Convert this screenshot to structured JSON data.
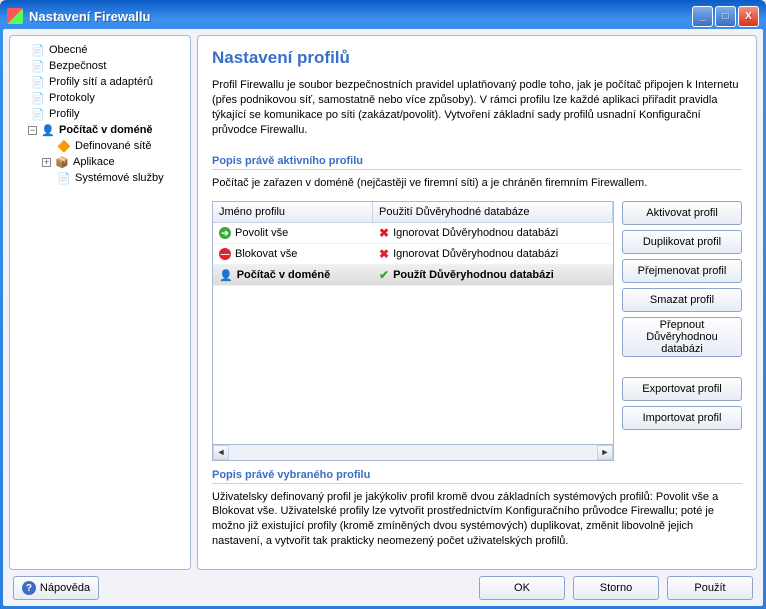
{
  "window": {
    "title": "Nastavení Firewallu",
    "buttons": {
      "min": "_",
      "max": "□",
      "close": "X"
    }
  },
  "tree": {
    "items": [
      {
        "label": "Obecné",
        "icon": "📄",
        "indent": 0,
        "expander": ""
      },
      {
        "label": "Bezpečnost",
        "icon": "📄",
        "indent": 0,
        "expander": ""
      },
      {
        "label": "Profily sítí a adaptérů",
        "icon": "📄",
        "indent": 0,
        "expander": ""
      },
      {
        "label": "Protokoly",
        "icon": "📄",
        "indent": 0,
        "expander": ""
      },
      {
        "label": "Profily",
        "icon": "📄",
        "indent": 0,
        "expander": ""
      },
      {
        "label": "Počítač v doméně",
        "icon": "👤",
        "indent": 1,
        "expander": "−",
        "bold": true
      },
      {
        "label": "Definované sítě",
        "icon": "🔶",
        "indent": 2,
        "expander": ""
      },
      {
        "label": "Aplikace",
        "icon": "📦",
        "indent": 2,
        "expander": "+"
      },
      {
        "label": "Systémové služby",
        "icon": "📄",
        "indent": 2,
        "expander": ""
      }
    ]
  },
  "content": {
    "title": "Nastavení profilů",
    "intro": "Profil Firewallu je soubor bezpečnostních pravidel uplatňovaný podle toho, jak je počítač připojen k Internetu (přes podnikovou síť, samostatně nebo více způsoby). V rámci profilu lze každé aplikaci přiřadit pravidla týkající se komunikace po síti (zakázat/povolit). Vytvoření základní sady profilů usnadní Konfigurační průvodce Firewallu.",
    "active_head": "Popis právě aktivního profilu",
    "active_text": "Počítač je zařazen v doméně (nejčastěji ve firemní síti) a je chráněn firemním Firewallem.",
    "table": {
      "col_name": "Jméno profilu",
      "col_db": "Použití Důvěryhodné databáze",
      "rows": [
        {
          "name": "Povolit vše",
          "db": "Ignorovat Důvěryhodnou databázi",
          "icon": "green",
          "use": false,
          "selected": false
        },
        {
          "name": "Blokovat vše",
          "db": "Ignorovat Důvěryhodnou databázi",
          "icon": "red",
          "use": false,
          "selected": false
        },
        {
          "name": "Počítač v doméně",
          "db": "Použít Důvěryhodnou databázi",
          "icon": "person",
          "use": true,
          "selected": true
        }
      ]
    },
    "buttons": {
      "activate": "Aktivovat profil",
      "duplicate": "Duplikovat profil",
      "rename": "Přejmenovat profil",
      "delete": "Smazat profil",
      "toggle": "Přepnout Důvěryhodnou databázi",
      "export": "Exportovat profil",
      "import": "Importovat profil"
    },
    "selected_head": "Popis právě vybraného profilu",
    "selected_text": "Uživatelsky definovaný profil je jakýkoliv profil kromě dvou základních systémových profilů: Povolit vše a Blokovat vše. Uživatelské profily lze vytvořit prostřednictvím Konfiguračního průvodce Firewallu; poté je možno již existující profily (kromě zmíněných dvou systémových) duplikovat, změnit libovolně jejich nastavení, a vytvořit tak prakticky neomezený počet uživatelských profilů."
  },
  "footer": {
    "help": "Nápověda",
    "ok": "OK",
    "cancel": "Storno",
    "apply": "Použít"
  }
}
